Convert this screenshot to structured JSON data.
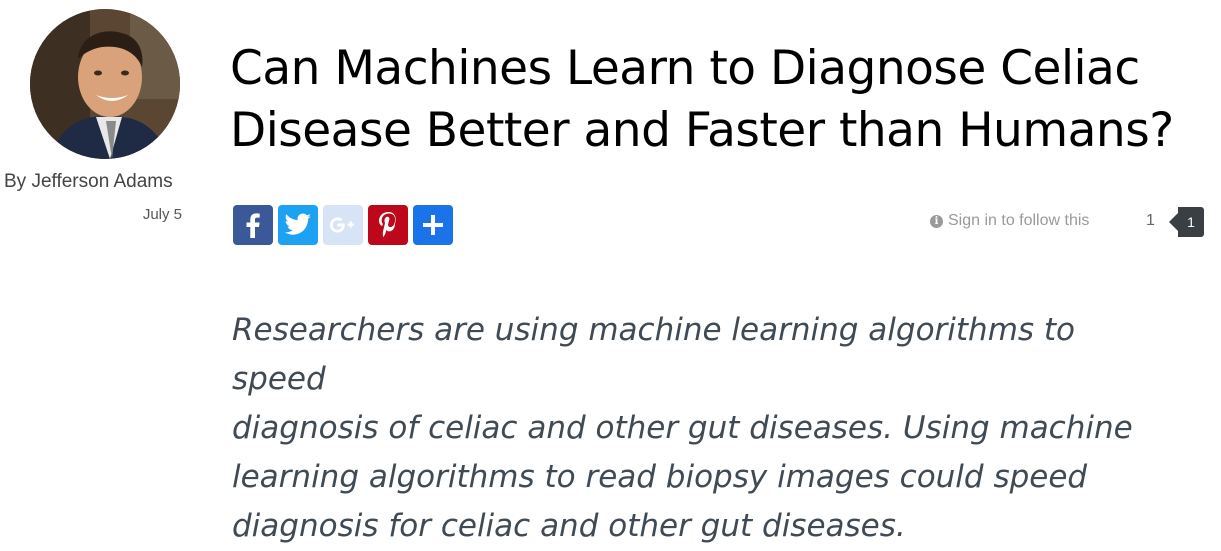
{
  "author": {
    "name": "By Jefferson Adams",
    "date": "July 5"
  },
  "article": {
    "title": "Can Machines Learn to Diagnose Celiac Disease Better and Faster than Humans?",
    "summary": "Researchers are using machine learning algorithms to speed\ndiagnosis of celiac and other gut diseases. Using machine\nlearning algorithms to read biopsy images could speed\ndiagnosis for celiac and other gut  diseases."
  },
  "share": {
    "buttons": [
      {
        "name": "facebook",
        "icon": "facebook-icon",
        "color": "#3b5998"
      },
      {
        "name": "twitter",
        "icon": "twitter-icon",
        "color": "#1da1f2"
      },
      {
        "name": "google-plus",
        "icon": "google-plus-icon",
        "color": "#d6e4f5"
      },
      {
        "name": "pinterest",
        "icon": "pinterest-icon",
        "color": "#bd081c"
      },
      {
        "name": "more",
        "icon": "plus-icon",
        "color": "#1a73e8"
      }
    ]
  },
  "follow": {
    "label": "Sign in to follow this",
    "count": "1",
    "badge_count": "1"
  }
}
